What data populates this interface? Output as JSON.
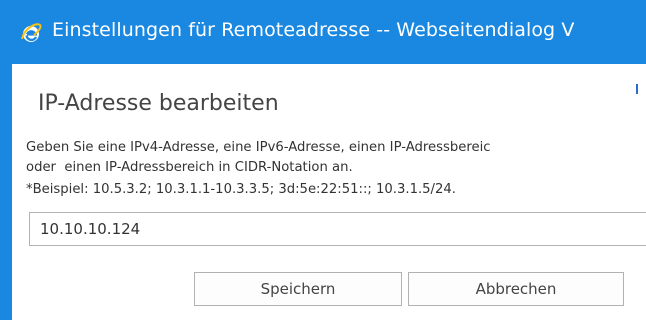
{
  "window": {
    "title": "Einstellungen für Remoteadresse -- Webseitendialog V",
    "icon": "internet-explorer-icon"
  },
  "dialog": {
    "heading": "IP-Adresse bearbeiten",
    "description_line1": "Geben Sie eine IPv4-Adresse, eine IPv6-Adresse, einen IP-Adressbereic",
    "description_line2": "oder  einen IP-Adressbereich in CIDR-Notation an.",
    "example": "*Beispiel: 10.5.3.2; 10.3.1.1-10.3.3.5; 3d:5e:22:51::; 10.3.1.5/24.",
    "ip_value": "10.10.10.124",
    "save_label": "Speichern",
    "cancel_label": "Abbrechen"
  },
  "colors": {
    "titlebar": "#1a87e0",
    "title_text": "#ffffff",
    "accent_tick": "#2b6cc4"
  }
}
